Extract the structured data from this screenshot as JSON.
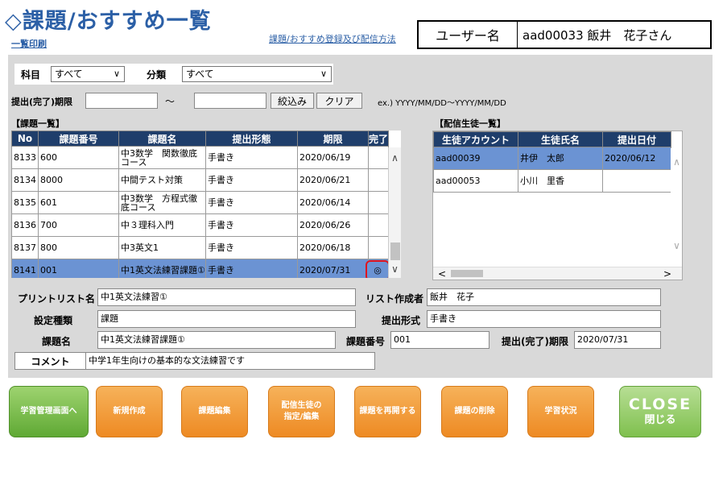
{
  "header": {
    "title": "◇課題/おすすめ一覧",
    "print_link": "一覧印刷",
    "register_link": "課題/おすすめ登録及び配信方法",
    "user_label": "ユーザー名",
    "user_value": "aad00033 飯井　花子さん"
  },
  "filters": {
    "subject_label": "科目",
    "subject_value": "すべて",
    "category_label": "分類",
    "category_value": "すべて",
    "deadline_label": "提出(完了)期限",
    "deadline_from": "",
    "tilde": "～",
    "deadline_to": "",
    "filter_button": "絞込み",
    "clear_button": "クリア",
    "date_hint": "ex.) YYYY/MM/DD～YYYY/MM/DD"
  },
  "assignments": {
    "section_title": "【課題一覧】",
    "columns": [
      "No",
      "課題番号",
      "課題名",
      "提出形態",
      "期限",
      "完了"
    ],
    "rows": [
      {
        "no": "8133",
        "code": "600",
        "name": "中3数学　関数徹底コース",
        "form": "手書き",
        "deadline": "2020/06/19",
        "done": ""
      },
      {
        "no": "8134",
        "code": "8000",
        "name": "中間テスト対策",
        "form": "手書き",
        "deadline": "2020/06/21",
        "done": ""
      },
      {
        "no": "8135",
        "code": "601",
        "name": "中3数学　方程式徹底コース",
        "form": "手書き",
        "deadline": "2020/06/14",
        "done": ""
      },
      {
        "no": "8136",
        "code": "700",
        "name": "中３理科入門",
        "form": "手書き",
        "deadline": "2020/06/26",
        "done": ""
      },
      {
        "no": "8137",
        "code": "800",
        "name": "中3英文1",
        "form": "手書き",
        "deadline": "2020/06/18",
        "done": ""
      },
      {
        "no": "8141",
        "code": "001",
        "name": "中1英文法練習課題①",
        "form": "手書き",
        "deadline": "2020/07/31",
        "done": "◎"
      }
    ]
  },
  "students": {
    "section_title": "【配信生徒一覧】",
    "columns": [
      "生徒アカウント",
      "生徒氏名",
      "提出日付"
    ],
    "rows": [
      {
        "account": "aad00039",
        "name": "井伊　太郎",
        "date": "2020/06/12"
      },
      {
        "account": "aad00053",
        "name": "小川　里香",
        "date": ""
      }
    ]
  },
  "detail": {
    "printlist_label": "プリントリスト名",
    "printlist_value": "中1英文法練習①",
    "creator_label": "リスト作成者",
    "creator_value": "飯井　花子",
    "type_label": "設定種類",
    "type_value": "課題",
    "format_label": "提出形式",
    "format_value": "手書き",
    "name_label": "課題名",
    "name_value": "中1英文法練習課題①",
    "number_label": "課題番号",
    "number_value": "001",
    "deadline_label": "提出(完了)期限",
    "deadline_value": "2020/07/31",
    "comment_label": "コメント",
    "comment_value": "中学1年生向けの基本的な文法練習です"
  },
  "buttons": {
    "manage": "学習管理画面へ",
    "create": "新規作成",
    "edit": "課題編集",
    "deliver_line1": "配信生徒の",
    "deliver_line2": "指定/編集",
    "reopen": "課題を再開する",
    "delete": "課題の削除",
    "status": "学習状況",
    "close_en": "CLOSE",
    "close_ja": "閉じる"
  },
  "colors": {
    "title_blue": "#2b5fa6",
    "header_navy": "#1f3e6b",
    "selected_row": "#6b93d3",
    "orange": "#ee8a23",
    "green": "#5fa934",
    "highlight_red": "#e0141e"
  }
}
